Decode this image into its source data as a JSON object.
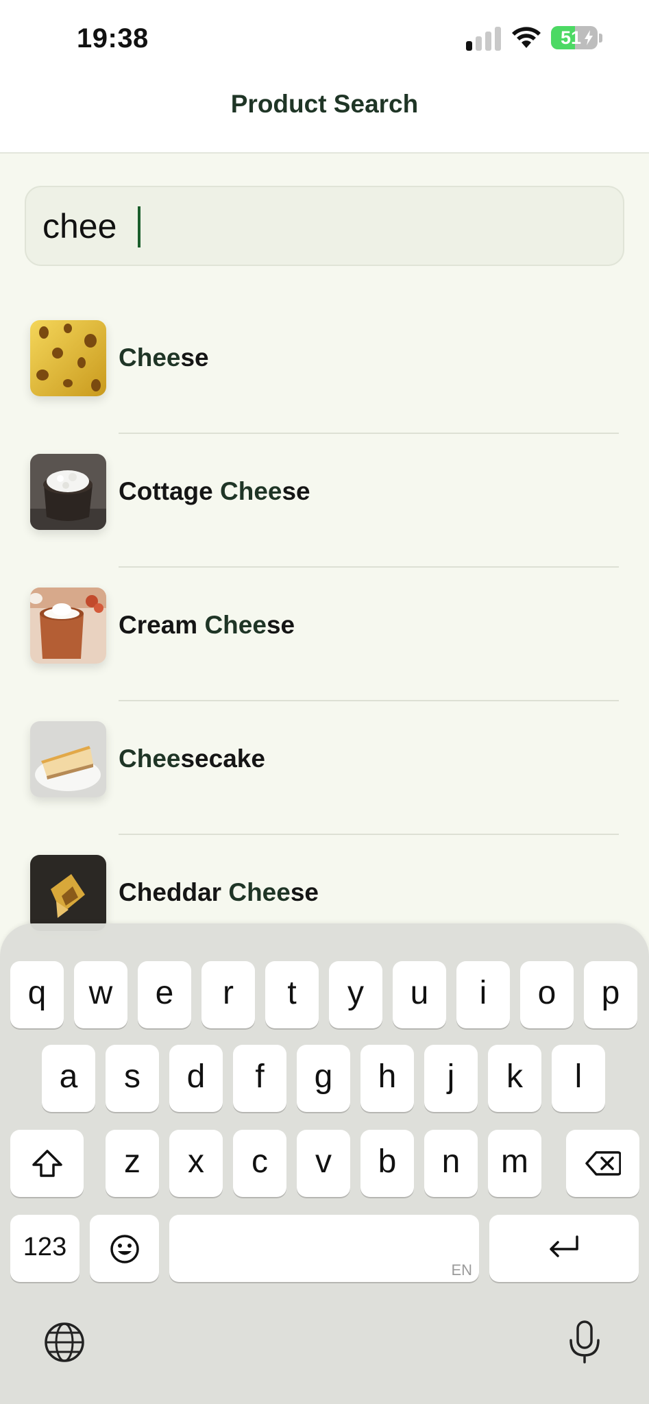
{
  "status_bar": {
    "time": "19:38",
    "battery_percent": "51"
  },
  "nav": {
    "title": "Product Search"
  },
  "search": {
    "value": "chee"
  },
  "results": [
    {
      "prefix": "",
      "match": "Chee",
      "suffix": "se",
      "image": "cheese-thumbnail"
    },
    {
      "prefix": "Cottage ",
      "match": "Chee",
      "suffix": "se",
      "image": "cottage-cheese-thumbnail"
    },
    {
      "prefix": "Cream ",
      "match": "Chee",
      "suffix": "se",
      "image": "cream-cheese-thumbnail"
    },
    {
      "prefix": "",
      "match": "Chee",
      "suffix": "secake",
      "image": "cheesecake-thumbnail"
    },
    {
      "prefix": "Cheddar ",
      "match": "Chee",
      "suffix": "se",
      "image": "cheddar-cheese-thumbnail"
    }
  ],
  "keyboard": {
    "row1": [
      "q",
      "w",
      "e",
      "r",
      "t",
      "y",
      "u",
      "i",
      "o",
      "p"
    ],
    "row2": [
      "a",
      "s",
      "d",
      "f",
      "g",
      "h",
      "j",
      "k",
      "l"
    ],
    "row3": [
      "z",
      "x",
      "c",
      "v",
      "b",
      "n",
      "m"
    ],
    "numbers_key": "123",
    "space_language": "EN",
    "icons": {
      "shift": "shift-icon",
      "delete": "delete-icon",
      "emoji": "emoji-icon",
      "return": "return-icon",
      "globe": "globe-icon",
      "mic": "microphone-icon"
    }
  },
  "colors": {
    "background": "#f6f8ef",
    "accent": "#1f3526",
    "caret": "#1b5e2c",
    "battery": "#4cd964"
  }
}
